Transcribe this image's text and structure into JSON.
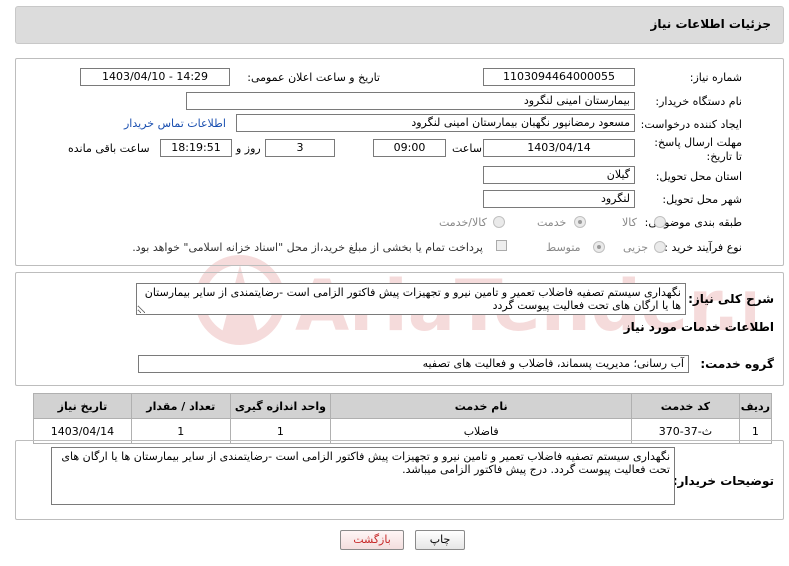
{
  "header": {
    "title": "جزئیات اطلاعات نیاز"
  },
  "form": {
    "need_number_label": "شماره نیاز:",
    "need_number": "1103094464000055",
    "announce_label": "تاریخ و ساعت اعلان عمومی:",
    "announce_value": "1403/04/10 - 14:29",
    "buyer_org_label": "نام دستگاه خریدار:",
    "buyer_org": "بیمارستان امینی لنگرود",
    "requester_label": "ایجاد کننده درخواست:",
    "requester": "مسعود رمضانپور نگهبان بیمارستان امینی لنگرود",
    "contact_link": "اطلاعات تماس خریدار",
    "deadline_label": "مهلت ارسال پاسخ: تا تاریخ:",
    "deadline_date": "1403/04/14",
    "time_label": "ساعت",
    "deadline_time": "09:00",
    "days_value": "3",
    "days_label": "روز و",
    "remaining_time": "18:19:51",
    "remaining_label": "ساعت باقی مانده",
    "province_label": "استان محل تحویل:",
    "province": "گیلان",
    "city_label": "شهر محل تحویل:",
    "city": "لنگرود",
    "category_label": "طبقه بندی موضوعی:",
    "category_options": [
      "کالا",
      "خدمت",
      "کالا/خدمت"
    ],
    "category_selected": "خدمت",
    "process_label": "نوع فرآیند خرید :",
    "process_options": [
      "جزیی",
      "متوسط"
    ],
    "process_selected": "متوسط",
    "payment_note": "پرداخت تمام یا بخشی از مبلغ خرید،از محل \"اسناد خزانه اسلامی\" خواهد بود."
  },
  "summary": {
    "label": "شرح کلی نیاز:",
    "text": "نگهداری سیستم تصفیه فاضلاب تعمیر و تامین نیرو و تجهیزات پیش فاکتور الزامی است -رضایتمندی از سایر بیمارستان ها یا ارگان های تحت فعالیت پیوست گردد"
  },
  "services": {
    "section_title": "اطلاعات خدمات مورد نیاز",
    "group_label": "گروه خدمت:",
    "group_value": "آب رسانی؛ مدیریت پسماند، فاضلاب و فعالیت های تصفیه",
    "columns": [
      "ردیف",
      "کد خدمت",
      "نام خدمت",
      "واحد اندازه گیری",
      "تعداد / مقدار",
      "تاریخ نیاز"
    ],
    "rows": [
      {
        "row": "1",
        "code": "ث-37-370",
        "name": "فاضلاب",
        "unit": "1",
        "qty": "1",
        "date": "1403/04/14"
      }
    ]
  },
  "buyer_notes": {
    "label": "توضیحات خریدار:",
    "text": "نگهداری سیستم تصفیه فاضلاب تعمیر و تامین نیرو و تجهیزات پیش فاکتور الزامی است -رضایتمندی از سایر بیمارستان ها یا ارگان های تحت فعالیت پیوست گردد. درج پیش فاکتور الزامی میباشد."
  },
  "buttons": {
    "print": "چاپ",
    "back": "بازگشت"
  },
  "watermark": {
    "text": "AriaTender.net"
  },
  "colors": {
    "link": "#1a4fb0",
    "back_button": "#c62828",
    "header_bg": "#dcdcdc"
  }
}
